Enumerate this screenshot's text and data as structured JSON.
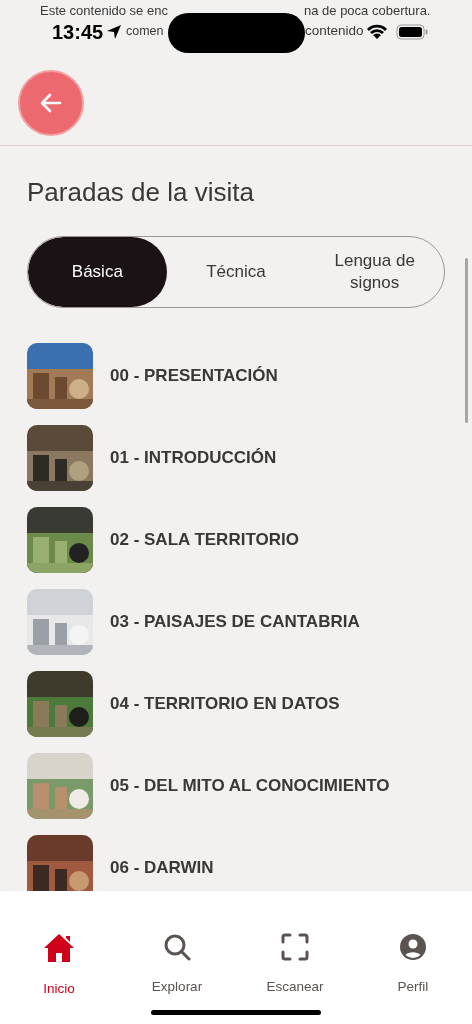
{
  "notice": {
    "line_1_start": "Este contenido se enc",
    "line_1_end": "na de poca cobertura.",
    "line_2_start": "comen",
    "line_2_end": "contenido"
  },
  "status_bar": {
    "time": "13:45"
  },
  "title": "Paradas de la visita",
  "tabs": [
    {
      "label": "Básica",
      "selected": true
    },
    {
      "label": "Técnica",
      "selected": false
    },
    {
      "label": "Lengua de signos",
      "selected": false
    }
  ],
  "stops": [
    {
      "title": "00 - PRESENTACIÓN",
      "kind": "picture"
    },
    {
      "title": "01 - INTRODUCCIÓN",
      "kind": "picture"
    },
    {
      "title": "02 - SALA TERRITORIO",
      "kind": "picture"
    },
    {
      "title": "03 - PAISAJES DE CANTABRIA",
      "kind": "picture"
    },
    {
      "title": "04 - TERRITORIO EN DATOS",
      "kind": "picture"
    },
    {
      "title": "05 - DEL MITO AL CONOCIMIENTO",
      "kind": "picture"
    },
    {
      "title": "06 - DARWIN",
      "kind": "picture"
    }
  ],
  "nav": [
    {
      "label": "Inicio",
      "selected": true
    },
    {
      "label": "Explorar",
      "selected": false
    },
    {
      "label": "Escanear",
      "selected": false
    },
    {
      "label": "Perfil",
      "selected": false
    }
  ]
}
